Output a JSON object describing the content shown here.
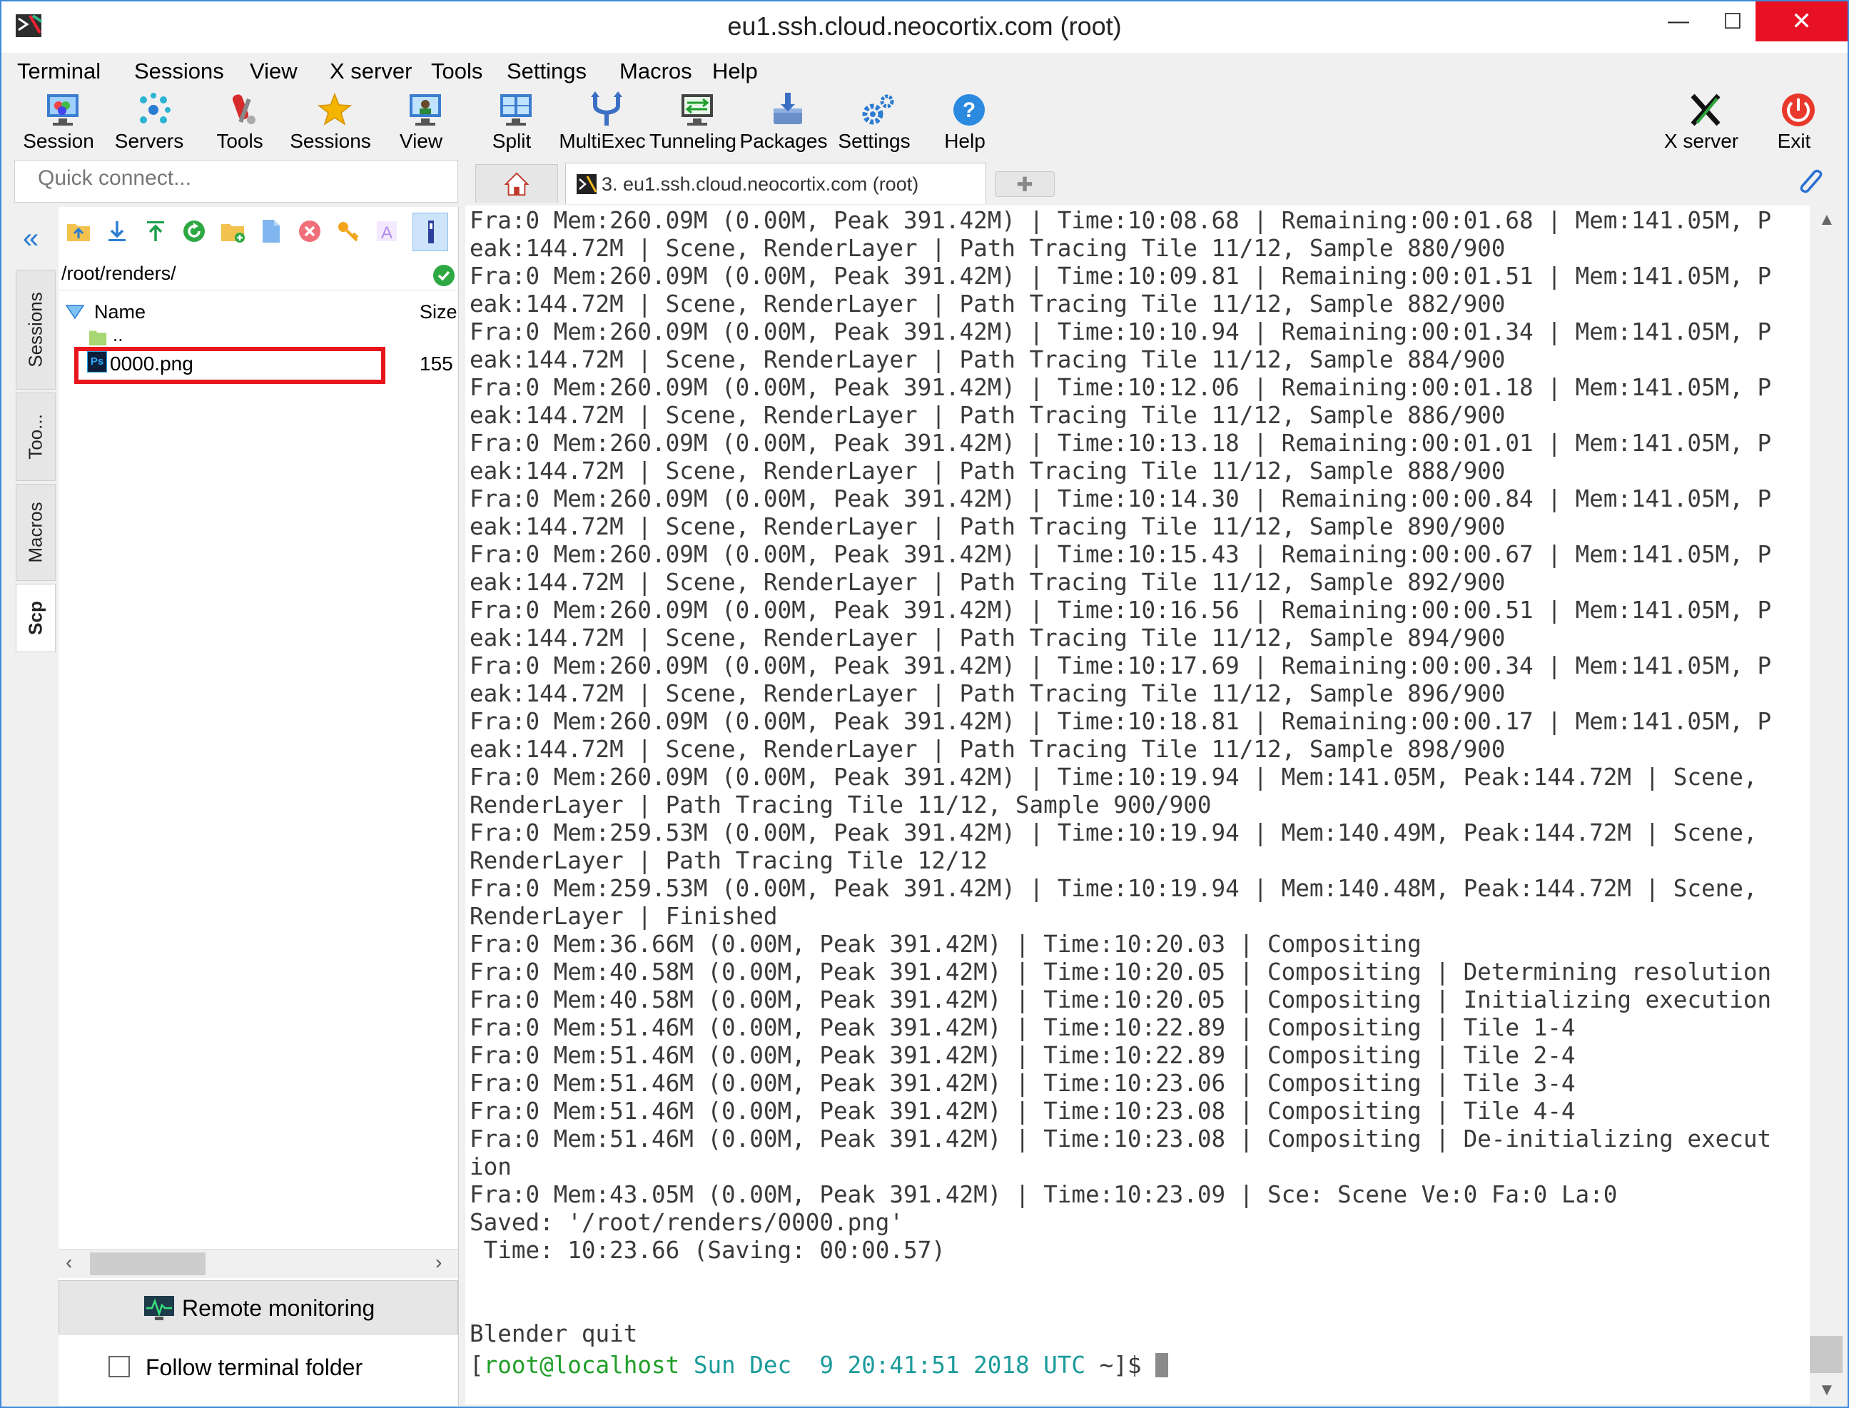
{
  "window": {
    "title": "eu1.ssh.cloud.neocortix.com (root)",
    "min_glyph": "—",
    "max_glyph": "☐",
    "close_glyph": "✕"
  },
  "menu": [
    "Terminal",
    "Sessions",
    "View",
    "X server",
    "Tools",
    "Settings",
    "Macros",
    "Help"
  ],
  "toolbar": {
    "left": [
      {
        "label": "Session",
        "icon": "session-icon"
      },
      {
        "label": "Servers",
        "icon": "servers-icon"
      },
      {
        "label": "Tools",
        "icon": "tools-icon"
      },
      {
        "label": "Sessions",
        "icon": "star-icon"
      },
      {
        "label": "View",
        "icon": "view-icon"
      },
      {
        "label": "Split",
        "icon": "split-icon"
      },
      {
        "label": "MultiExec",
        "icon": "multiexec-icon"
      },
      {
        "label": "Tunneling",
        "icon": "tunneling-icon"
      },
      {
        "label": "Packages",
        "icon": "packages-icon"
      },
      {
        "label": "Settings",
        "icon": "settings-icon"
      },
      {
        "label": "Help",
        "icon": "help-icon"
      }
    ],
    "right": [
      {
        "label": "X server",
        "icon": "xserver-icon"
      },
      {
        "label": "Exit",
        "icon": "power-icon"
      }
    ]
  },
  "quick_connect": {
    "placeholder": "Quick connect..."
  },
  "tabs": {
    "active_label": "3. eu1.ssh.cloud.neocortix.com (root)",
    "new_tab_glyph": "✚"
  },
  "side_tabs": [
    "Sessions",
    "Too...",
    "Macros",
    "Scp"
  ],
  "file_browser": {
    "path": "/root/renders/",
    "columns": {
      "name": "Name",
      "size": "Size"
    },
    "parent_entry": "..",
    "files": [
      {
        "name": "0000.png",
        "size": "155",
        "type_badge": "Ps"
      }
    ],
    "remote_monitoring": "Remote monitoring",
    "follow_terminal_folder": "Follow terminal folder",
    "follow_checked": false
  },
  "terminal": {
    "lines": [
      "Fra:0 Mem:260.09M (0.00M, Peak 391.42M) | Time:10:08.68 | Remaining:00:01.68 | Mem:141.05M, P",
      "eak:144.72M | Scene, RenderLayer | Path Tracing Tile 11/12, Sample 880/900",
      "Fra:0 Mem:260.09M (0.00M, Peak 391.42M) | Time:10:09.81 | Remaining:00:01.51 | Mem:141.05M, P",
      "eak:144.72M | Scene, RenderLayer | Path Tracing Tile 11/12, Sample 882/900",
      "Fra:0 Mem:260.09M (0.00M, Peak 391.42M) | Time:10:10.94 | Remaining:00:01.34 | Mem:141.05M, P",
      "eak:144.72M | Scene, RenderLayer | Path Tracing Tile 11/12, Sample 884/900",
      "Fra:0 Mem:260.09M (0.00M, Peak 391.42M) | Time:10:12.06 | Remaining:00:01.18 | Mem:141.05M, P",
      "eak:144.72M | Scene, RenderLayer | Path Tracing Tile 11/12, Sample 886/900",
      "Fra:0 Mem:260.09M (0.00M, Peak 391.42M) | Time:10:13.18 | Remaining:00:01.01 | Mem:141.05M, P",
      "eak:144.72M | Scene, RenderLayer | Path Tracing Tile 11/12, Sample 888/900",
      "Fra:0 Mem:260.09M (0.00M, Peak 391.42M) | Time:10:14.30 | Remaining:00:00.84 | Mem:141.05M, P",
      "eak:144.72M | Scene, RenderLayer | Path Tracing Tile 11/12, Sample 890/900",
      "Fra:0 Mem:260.09M (0.00M, Peak 391.42M) | Time:10:15.43 | Remaining:00:00.67 | Mem:141.05M, P",
      "eak:144.72M | Scene, RenderLayer | Path Tracing Tile 11/12, Sample 892/900",
      "Fra:0 Mem:260.09M (0.00M, Peak 391.42M) | Time:10:16.56 | Remaining:00:00.51 | Mem:141.05M, P",
      "eak:144.72M | Scene, RenderLayer | Path Tracing Tile 11/12, Sample 894/900",
      "Fra:0 Mem:260.09M (0.00M, Peak 391.42M) | Time:10:17.69 | Remaining:00:00.34 | Mem:141.05M, P",
      "eak:144.72M | Scene, RenderLayer | Path Tracing Tile 11/12, Sample 896/900",
      "Fra:0 Mem:260.09M (0.00M, Peak 391.42M) | Time:10:18.81 | Remaining:00:00.17 | Mem:141.05M, P",
      "eak:144.72M | Scene, RenderLayer | Path Tracing Tile 11/12, Sample 898/900",
      "Fra:0 Mem:260.09M (0.00M, Peak 391.42M) | Time:10:19.94 | Mem:141.05M, Peak:144.72M | Scene,",
      "RenderLayer | Path Tracing Tile 11/12, Sample 900/900",
      "Fra:0 Mem:259.53M (0.00M, Peak 391.42M) | Time:10:19.94 | Mem:140.49M, Peak:144.72M | Scene,",
      "RenderLayer | Path Tracing Tile 12/12",
      "Fra:0 Mem:259.53M (0.00M, Peak 391.42M) | Time:10:19.94 | Mem:140.48M, Peak:144.72M | Scene,",
      "RenderLayer | Finished",
      "Fra:0 Mem:36.66M (0.00M, Peak 391.42M) | Time:10:20.03 | Compositing",
      "Fra:0 Mem:40.58M (0.00M, Peak 391.42M) | Time:10:20.05 | Compositing | Determining resolution",
      "Fra:0 Mem:40.58M (0.00M, Peak 391.42M) | Time:10:20.05 | Compositing | Initializing execution",
      "Fra:0 Mem:51.46M (0.00M, Peak 391.42M) | Time:10:22.89 | Compositing | Tile 1-4",
      "Fra:0 Mem:51.46M (0.00M, Peak 391.42M) | Time:10:22.89 | Compositing | Tile 2-4",
      "Fra:0 Mem:51.46M (0.00M, Peak 391.42M) | Time:10:23.06 | Compositing | Tile 3-4",
      "Fra:0 Mem:51.46M (0.00M, Peak 391.42M) | Time:10:23.08 | Compositing | Tile 4-4",
      "Fra:0 Mem:51.46M (0.00M, Peak 391.42M) | Time:10:23.08 | Compositing | De-initializing execut",
      "ion",
      "Fra:0 Mem:43.05M (0.00M, Peak 391.42M) | Time:10:23.09 | Sce: Scene Ve:0 Fa:0 La:0",
      "Saved: '/root/renders/0000.png'",
      " Time: 10:23.66 (Saving: 00:00.57)",
      "",
      "",
      "Blender quit"
    ],
    "prompt": {
      "open": "[",
      "user_host": "root@localhost",
      "datetime": " Sun Dec  9 20:41:51 2018 UTC",
      "dir": " ~",
      "close": "]$ "
    }
  },
  "colors": {
    "close_button": "#e81123",
    "accent_blue": "#2b7cd3",
    "prompt_green": "#1f9e28",
    "prompt_cyan": "#1c9b9b",
    "highlight_red": "#e8161c"
  }
}
